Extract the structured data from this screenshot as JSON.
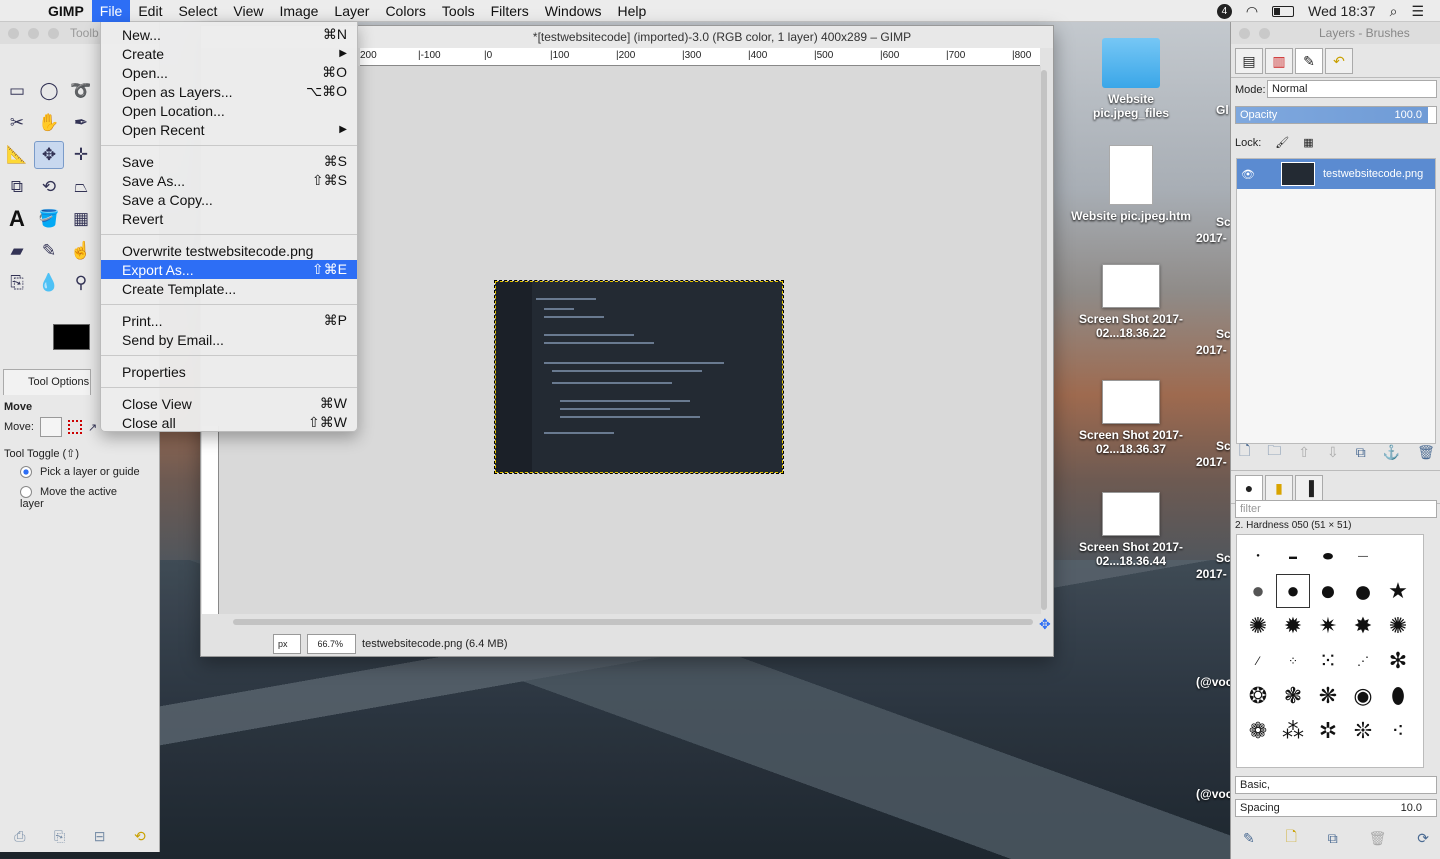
{
  "menubar": {
    "apple": "",
    "app": "GIMP",
    "items": [
      "File",
      "Edit",
      "Select",
      "View",
      "Image",
      "Layer",
      "Colors",
      "Tools",
      "Filters",
      "Windows",
      "Help"
    ],
    "active": "File",
    "clock": "Wed 18:37",
    "badge": "4"
  },
  "toolbox": {
    "title": "Toolb",
    "tool_options_tab": "Tool Options",
    "move_heading": "Move",
    "move_label": "Move:",
    "tool_toggle": "Tool Toggle  (⇧)",
    "option_pick": "Pick a layer or guide",
    "option_move": "Move the active layer"
  },
  "image_window": {
    "title": "*[testwebsitecode] (imported)-3.0 (RGB color, 1 layer) 400x289 – GIMP",
    "ruler_labels": [
      "200",
      "|-100",
      "|0",
      "|100",
      "|200",
      "|300",
      "|400",
      "|500",
      "|600",
      "|700",
      "|800"
    ],
    "unit": "px",
    "zoom": "66.7%",
    "status": "testwebsitecode.png (6.4 MB)"
  },
  "file_menu": {
    "groups": [
      [
        {
          "label": "New...",
          "shortcut": "⌘N"
        },
        {
          "label": "Create",
          "shortcut": "▶"
        },
        {
          "label": "Open...",
          "shortcut": "⌘O"
        },
        {
          "label": "Open as Layers...",
          "shortcut": "⌥⌘O"
        },
        {
          "label": "Open Location...",
          "shortcut": ""
        },
        {
          "label": "Open Recent",
          "shortcut": "▶"
        }
      ],
      [
        {
          "label": "Save",
          "shortcut": "⌘S"
        },
        {
          "label": "Save As...",
          "shortcut": "⇧⌘S"
        },
        {
          "label": "Save a Copy...",
          "shortcut": ""
        },
        {
          "label": "Revert",
          "shortcut": ""
        }
      ],
      [
        {
          "label": "Overwrite testwebsitecode.png",
          "shortcut": ""
        },
        {
          "label": "Export As...",
          "shortcut": "⇧⌘E",
          "highlighted": true
        },
        {
          "label": "Create Template...",
          "shortcut": ""
        }
      ],
      [
        {
          "label": "Print...",
          "shortcut": "⌘P"
        },
        {
          "label": "Send by Email...",
          "shortcut": ""
        }
      ],
      [
        {
          "label": "Properties",
          "shortcut": ""
        }
      ],
      [
        {
          "label": "Close View",
          "shortcut": "⌘W"
        },
        {
          "label": "Close all",
          "shortcut": "⇧⌘W"
        }
      ]
    ]
  },
  "desktop": {
    "icons": [
      {
        "label": "Website pic.jpeg_files",
        "kind": "folder"
      },
      {
        "label": "Website pic.jpeg.htm",
        "kind": "doc"
      },
      {
        "label": "Screen Shot 2017-02...18.36.22",
        "kind": "shot"
      },
      {
        "label": "Screen Shot 2017-02...18.36.37",
        "kind": "shot"
      },
      {
        "label": "Screen Shot 2017-02...18.36.44",
        "kind": "shot"
      }
    ],
    "partial": [
      "Gl",
      "Sc",
      "2017-",
      "Sc",
      "2017-",
      "Sc",
      "2017-",
      "Sc",
      "2017-",
      "(@voc",
      "(@voc"
    ]
  },
  "dock": {
    "title": "Layers - Brushes",
    "mode_label": "Mode:",
    "mode_value": "Normal",
    "opacity_label": "Opacity",
    "opacity_value": "100.0",
    "lock_label": "Lock:",
    "layer_name": "testwebsitecode.png",
    "brush_filter_placeholder": "filter",
    "brush_name": "2. Hardness 050 (51 × 51)",
    "preset": "Basic,",
    "spacing_label": "Spacing",
    "spacing_value": "10.0"
  }
}
